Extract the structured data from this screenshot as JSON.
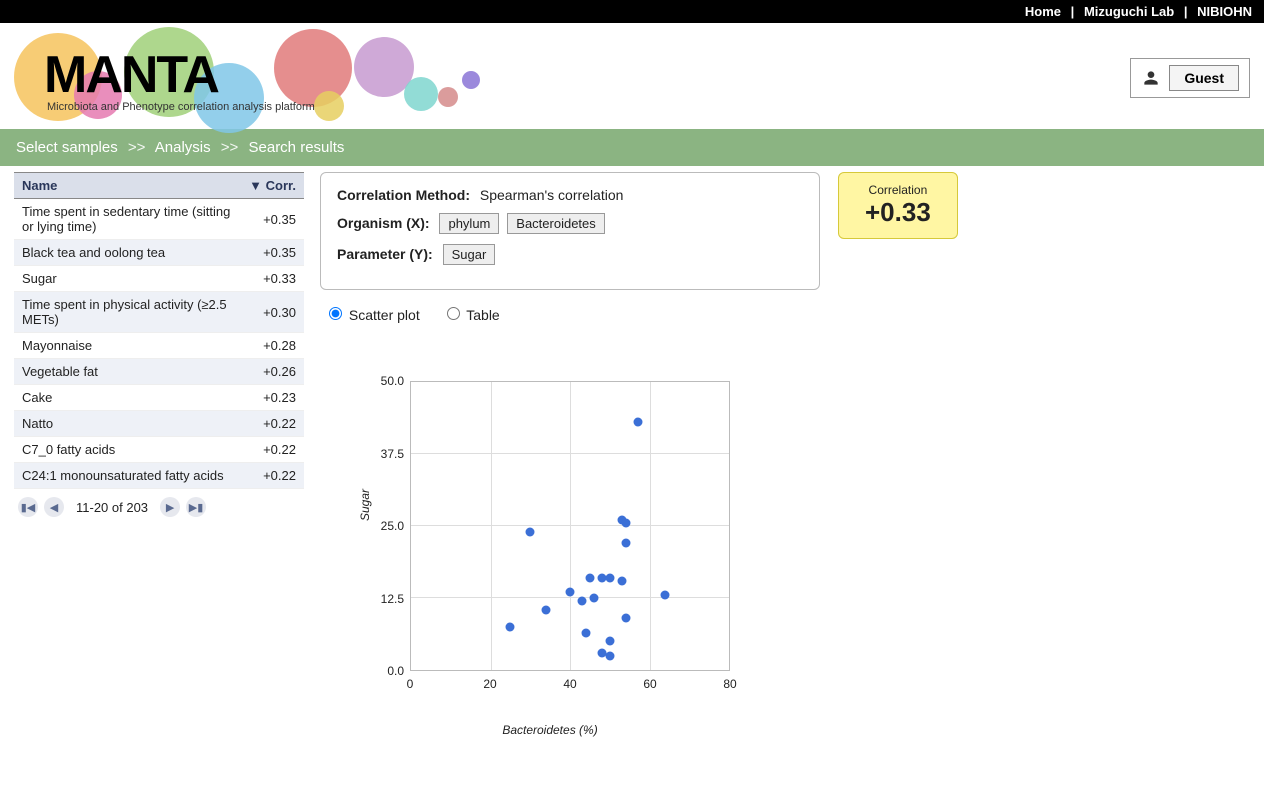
{
  "topnav": {
    "home": "Home",
    "lab": "Mizuguchi Lab",
    "org": "NIBIOHN",
    "sep": "|"
  },
  "logo": {
    "name": "MANTA",
    "subtitle": "Microbiota and Phenotype correlation analysis platform"
  },
  "user": {
    "label": "Guest"
  },
  "breadcrumb": {
    "a": "Select samples",
    "b": "Analysis",
    "c": "Search results",
    "sep": ">>"
  },
  "table": {
    "col_name": "Name",
    "col_corr": "Corr.",
    "sort_glyph": "▼",
    "rows": [
      {
        "name": "Time spent in sedentary time (sitting or lying time)",
        "corr": "+0.35"
      },
      {
        "name": "Black tea and oolong tea",
        "corr": "+0.35"
      },
      {
        "name": "Sugar",
        "corr": "+0.33"
      },
      {
        "name": "Time spent in physical activity (≥2.5 METs)",
        "corr": "+0.30"
      },
      {
        "name": "Mayonnaise",
        "corr": "+0.28"
      },
      {
        "name": "Vegetable fat",
        "corr": "+0.26"
      },
      {
        "name": "Cake",
        "corr": "+0.23"
      },
      {
        "name": "Natto",
        "corr": "+0.22"
      },
      {
        "name": "C7_0 fatty acids",
        "corr": "+0.22"
      },
      {
        "name": "C24:1 monounsaturated fatty acids",
        "corr": "+0.22"
      }
    ]
  },
  "pager": {
    "range": "11-20 of 203"
  },
  "info": {
    "method_label": "Correlation Method:",
    "method_value": "Spearman's correlation",
    "orgx_label": "Organism (X):",
    "orgx_tag1": "phylum",
    "orgx_tag2": "Bacteroidetes",
    "paramy_label": "Parameter (Y):",
    "paramy_tag": "Sugar"
  },
  "corr_badge": {
    "title": "Correlation",
    "value": "+0.33"
  },
  "view": {
    "scatter": "Scatter plot",
    "table": "Table"
  },
  "chart_data": {
    "type": "scatter",
    "xlabel": "Bacteroidetes (%)",
    "ylabel": "Sugar",
    "xlim": [
      0,
      80
    ],
    "ylim": [
      0,
      50
    ],
    "xticks": [
      0,
      20,
      40,
      60,
      80
    ],
    "yticks": [
      0.0,
      12.5,
      25.0,
      37.5,
      50.0
    ],
    "points": [
      {
        "x": 57,
        "y": 43
      },
      {
        "x": 30,
        "y": 24
      },
      {
        "x": 53,
        "y": 26
      },
      {
        "x": 54,
        "y": 25.5
      },
      {
        "x": 54,
        "y": 22
      },
      {
        "x": 45,
        "y": 16
      },
      {
        "x": 48,
        "y": 16
      },
      {
        "x": 50,
        "y": 16
      },
      {
        "x": 53,
        "y": 15.5
      },
      {
        "x": 64,
        "y": 13
      },
      {
        "x": 40,
        "y": 13.5
      },
      {
        "x": 43,
        "y": 12
      },
      {
        "x": 46,
        "y": 12.5
      },
      {
        "x": 34,
        "y": 10.5
      },
      {
        "x": 54,
        "y": 9
      },
      {
        "x": 25,
        "y": 7.5
      },
      {
        "x": 44,
        "y": 6.5
      },
      {
        "x": 50,
        "y": 5
      },
      {
        "x": 48,
        "y": 3
      },
      {
        "x": 50,
        "y": 2.5
      }
    ]
  }
}
